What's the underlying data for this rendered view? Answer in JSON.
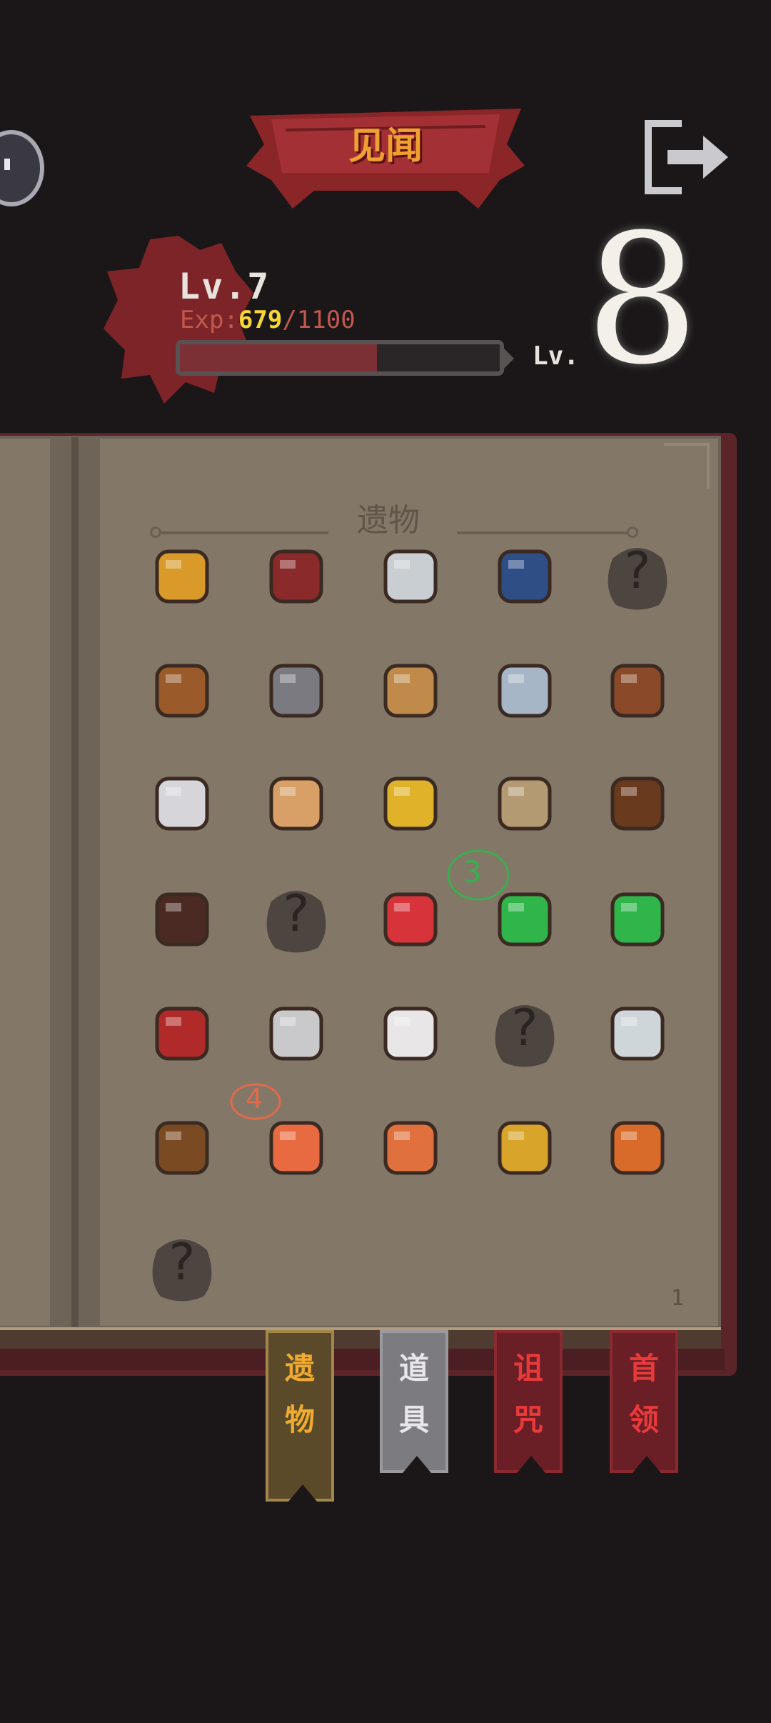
{
  "header": {
    "title": "见闻"
  },
  "player": {
    "level_label": "Lv.7",
    "exp_prefix": "Exp:",
    "exp_current": "679",
    "exp_max": "/1100",
    "exp_fraction": 0.617,
    "next_level_prefix": "Lv.",
    "next_level_value": "8"
  },
  "book": {
    "section_title": "遗物",
    "page_number": "1",
    "unknown_mark": "?",
    "relics": [
      {
        "icon": "gold-medal-icon",
        "known": true
      },
      {
        "icon": "hourglass-icon",
        "known": true
      },
      {
        "icon": "mirror-icon",
        "known": true
      },
      {
        "icon": "blue-berries-icon",
        "known": true
      },
      {
        "icon": "unknown-icon",
        "known": false
      },
      {
        "icon": "potion-bowl-icon",
        "known": true
      },
      {
        "icon": "lantern-icon",
        "known": true
      },
      {
        "icon": "torch-icon",
        "known": true
      },
      {
        "icon": "compass-icon",
        "known": true
      },
      {
        "icon": "vase-icon",
        "known": true
      },
      {
        "icon": "white-kettle-icon",
        "known": true
      },
      {
        "icon": "lucky-cat-icon",
        "known": true
      },
      {
        "icon": "gold-bell-icon",
        "known": true
      },
      {
        "icon": "map-scroll-icon",
        "known": true
      },
      {
        "icon": "spider-shrine-icon",
        "known": true
      },
      {
        "icon": "cabinet-icon",
        "known": true
      },
      {
        "icon": "unknown-icon",
        "known": false
      },
      {
        "icon": "red-glove-icon",
        "known": true
      },
      {
        "icon": "green-scroll-icon",
        "known": true
      },
      {
        "icon": "green-scroll-icon",
        "known": true
      },
      {
        "icon": "ticket-icon",
        "known": true
      },
      {
        "icon": "dollar-coin-icon",
        "known": true
      },
      {
        "icon": "white-ghost-icon",
        "known": true
      },
      {
        "icon": "unknown-icon",
        "known": false
      },
      {
        "icon": "pocket-watch-icon",
        "known": true
      },
      {
        "icon": "coin-sack-icon",
        "known": true
      },
      {
        "icon": "orange-fox-icon",
        "known": true
      },
      {
        "icon": "clay-pot-icon",
        "known": true
      },
      {
        "icon": "gold-jar-icon",
        "known": true
      },
      {
        "icon": "sunflower-icon",
        "known": true
      },
      {
        "icon": "unknown-icon",
        "known": false
      }
    ]
  },
  "tabs": {
    "relic": [
      "遗",
      "物"
    ],
    "item": [
      "道",
      "具"
    ],
    "curse": [
      "诅",
      "咒"
    ],
    "boss": [
      "首",
      "领"
    ]
  },
  "annotations": {
    "mark_a": "3",
    "mark_b": "4"
  },
  "colors": {
    "bg": "#1b1718",
    "gold": "#f0aa30",
    "exp_value": "#f5d735",
    "curse_red": "#e83a3a"
  }
}
